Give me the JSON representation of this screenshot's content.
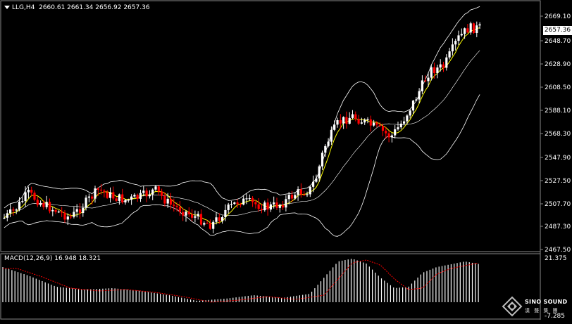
{
  "header": {
    "symbol": "LLG,H4",
    "ohlc": "2660.61 2661.34 2656.92 2657.36"
  },
  "current_price": "2657.36",
  "price_axis_labels": [
    "2669.10",
    "2648.70",
    "2628.90",
    "2608.50",
    "2588.10",
    "2568.30",
    "2547.90",
    "2527.50",
    "2507.70",
    "2487.30",
    "2467.50"
  ],
  "macd": {
    "label": "MACD(12,26,9) 16.948 18.321",
    "axis_top": "21.375",
    "axis_bottom": "-7.285"
  },
  "watermark": {
    "line1": "SINO SOUND",
    "line2": "漢 聲 集 團"
  },
  "colors": {
    "background": "#000000",
    "up_candle": "#ffffff",
    "down_candle": "#ff0000",
    "bollinger": "#ffffff",
    "moving_average": "#ffff00",
    "macd_histogram": "#ffffff",
    "macd_signal": "#ff0000"
  },
  "chart_data": {
    "type": "candlestick",
    "symbol": "LLG",
    "timeframe": "H4",
    "last_close": 2657.36,
    "ylim": [
      2467.5,
      2669.1
    ],
    "macd_params": [
      12,
      26,
      9
    ],
    "macd_value": 16.948,
    "macd_signal_value": 18.321,
    "macd_ylim": [
      -7.285,
      21.375
    ]
  }
}
